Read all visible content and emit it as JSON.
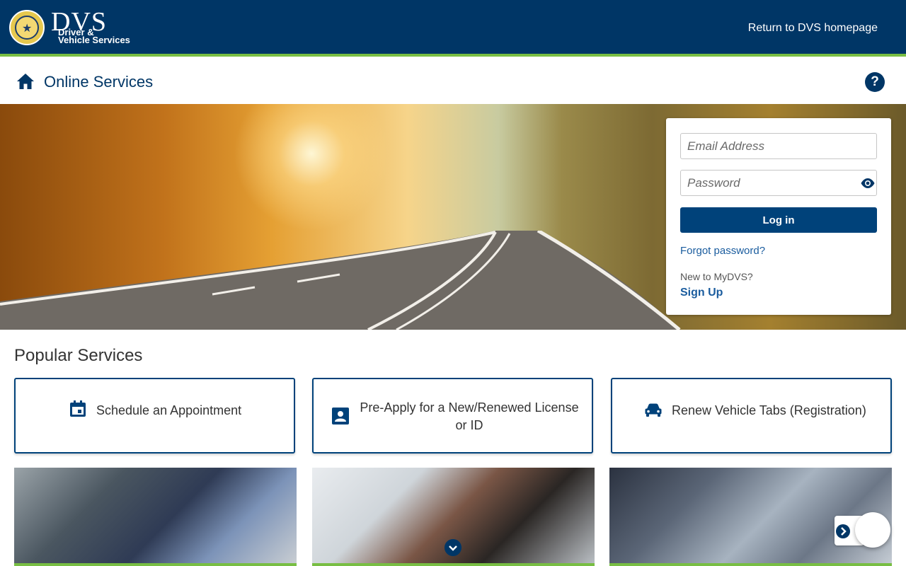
{
  "header": {
    "brand_dvs": "DVS",
    "brand_line1": "Driver &",
    "brand_line2": "Vehicle Services",
    "return_link": "Return to DVS homepage"
  },
  "subheader": {
    "title": "Online Services",
    "help_label": "?"
  },
  "login": {
    "email_placeholder": "Email Address",
    "password_placeholder": "Password",
    "login_button": "Log in",
    "forgot_password": "Forgot password?",
    "new_to": "New to MyDVS?",
    "sign_up": "Sign Up"
  },
  "popular": {
    "title": "Popular Services",
    "cards": [
      {
        "label": "Schedule an Appointment",
        "icon": "calendar-icon"
      },
      {
        "label": "Pre-Apply for a New/Renewed License or ID",
        "icon": "id-card-icon"
      },
      {
        "label": "Renew Vehicle Tabs (Registration)",
        "icon": "car-icon"
      }
    ]
  },
  "colors": {
    "navy": "#003666",
    "accent_green": "#78be43",
    "button_blue": "#00427a",
    "link_blue": "#1a5c9e"
  }
}
